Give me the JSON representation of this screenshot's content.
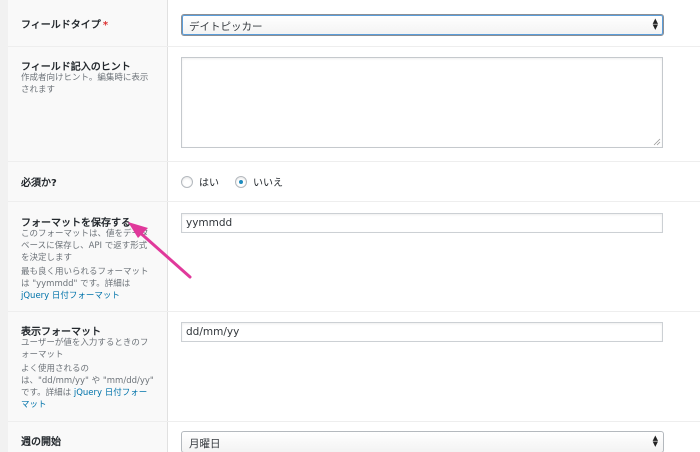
{
  "fields": {
    "field_type": {
      "label": "フィールドタイプ",
      "required_mark": "*",
      "select_value": "デイトピッカー"
    },
    "field_hint": {
      "label": "フィールド記入のヒント",
      "desc_lines": [
        "作成者向けヒント。編集時に表示",
        "されます"
      ],
      "value": ""
    },
    "required": {
      "label": "必須か?",
      "options": [
        "はい",
        "いいえ"
      ],
      "selected": "いいえ"
    },
    "save_format": {
      "label": "フォーマットを保存する",
      "desc_lines": [
        "このフォーマットは、値をデータ",
        "ベースに保存し、API で返す形式",
        "を決定します"
      ],
      "desc2_lines": [
        "最も良く用いられるフォーマット",
        "は \"yymmdd\" です。詳細は"
      ],
      "link": "jQuery 日付フォーマット",
      "value": "yymmdd"
    },
    "display_format": {
      "label": "表示フォーマット",
      "desc_lines": [
        "ユーザーが値を入力するときのフ",
        "ォーマット"
      ],
      "desc2_lines": [
        "よく使用されるの",
        "は、\"dd/mm/yy\" や \"mm/dd/yy\""
      ],
      "desc3_prefix": "です。詳細は ",
      "link_part1": "jQuery 日付フォー",
      "link_part2": "マット",
      "value": "dd/mm/yy"
    },
    "week_start": {
      "label": "週の開始",
      "select_value": "月曜日"
    }
  },
  "colors": {
    "annotation_arrow": "#e0399b",
    "link": "#0073aa",
    "required": "#dc3232"
  }
}
